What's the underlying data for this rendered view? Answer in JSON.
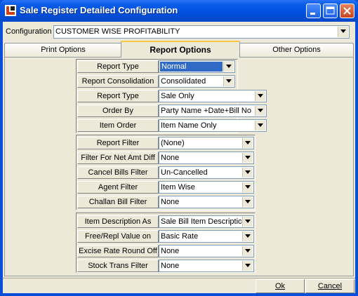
{
  "window": {
    "title": "Sale Register Detailed Configuration"
  },
  "configuration": {
    "label": "Configuration",
    "value": "CUSTOMER WISE PROFITABILITY"
  },
  "tabs": [
    {
      "label": "Print Options",
      "active": false
    },
    {
      "label": "Report Options",
      "active": true
    },
    {
      "label": "Other Options",
      "active": false
    }
  ],
  "options": [
    {
      "label": "Report Type",
      "value": "Normal",
      "selected": true
    },
    {
      "label": "Report Consolidation",
      "value": "Consolidated"
    },
    {
      "label": "Report Type",
      "value": "Sale Only"
    },
    {
      "label": "Order By",
      "value": "Party Name +Date+Bill No"
    },
    {
      "label": "Item Order",
      "value": "Item Name Only"
    },
    {
      "label": "Report Filter",
      "value": "(None)"
    },
    {
      "label": "Filter For Net Amt Diff",
      "value": "None"
    },
    {
      "label": "Cancel Bills Filter",
      "value": "Un-Cancelled"
    },
    {
      "label": "Agent Filter",
      "value": "Item Wise"
    },
    {
      "label": "Challan Bill Filter",
      "value": "None"
    },
    {
      "label": "Item Description As",
      "value": "Sale Bill Item Description"
    },
    {
      "label": "Free/Repl Value on",
      "value": "Basic Rate"
    },
    {
      "label": "Excise Rate Round Off",
      "value": "None"
    },
    {
      "label": "Stock Trans Filter",
      "value": "None"
    }
  ],
  "buttons": {
    "ok": "Ok",
    "cancel": "Cancel"
  },
  "colors": {
    "title_bar": "#0050dc",
    "face": "#ece9d8",
    "selection": "#316ac5",
    "tab_hot": "#ffc83c"
  }
}
